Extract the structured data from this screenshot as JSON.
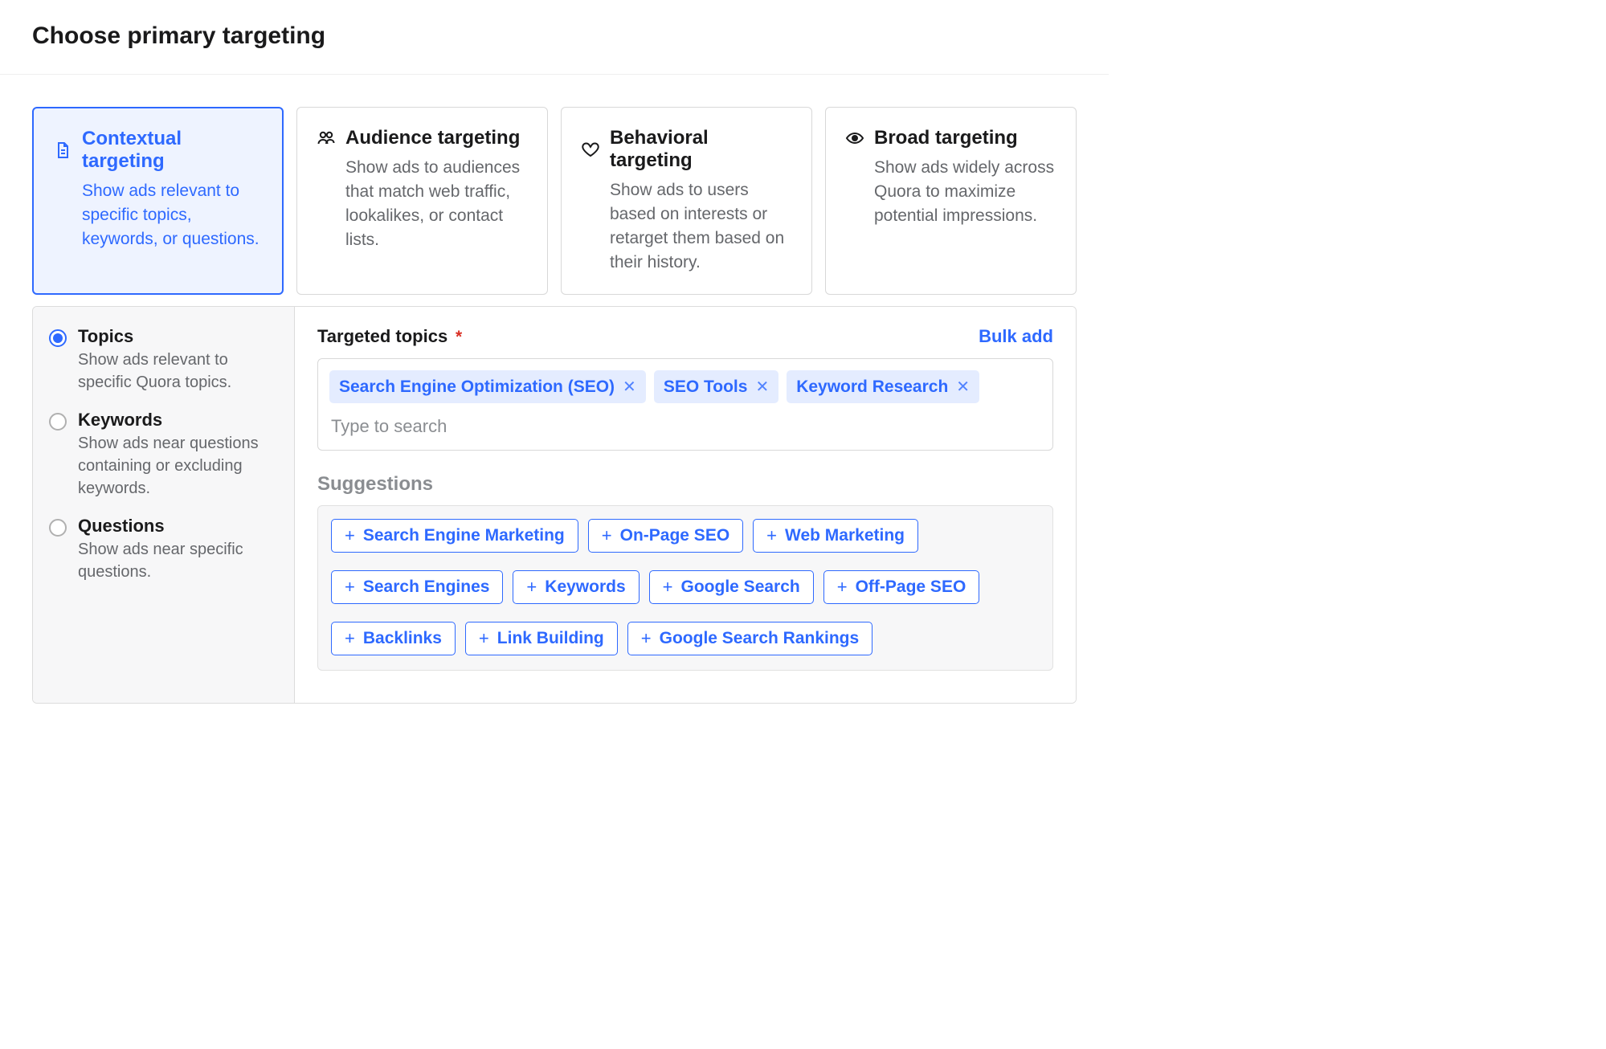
{
  "title": "Choose primary targeting",
  "cards": [
    {
      "title": "Contextual targeting",
      "desc": "Show ads relevant to specific topics, keywords, or questions.",
      "selected": true,
      "icon": "document-icon"
    },
    {
      "title": "Audience targeting",
      "desc": "Show ads to audiences that match web traffic, lookalikes, or contact lists.",
      "selected": false,
      "icon": "people-icon"
    },
    {
      "title": "Behavioral targeting",
      "desc": "Show ads to users based on interests or retarget them based on their history.",
      "selected": false,
      "icon": "heart-icon"
    },
    {
      "title": "Broad targeting",
      "desc": "Show ads widely across Quora to maximize potential impressions.",
      "selected": false,
      "icon": "eye-icon"
    }
  ],
  "side": {
    "options": [
      {
        "label": "Topics",
        "desc": "Show ads relevant to specific Quora topics.",
        "checked": true
      },
      {
        "label": "Keywords",
        "desc": "Show ads near questions containing or excluding keywords.",
        "checked": false
      },
      {
        "label": "Questions",
        "desc": "Show ads near specific questions.",
        "checked": false
      }
    ]
  },
  "main": {
    "field_label": "Targeted topics",
    "required_mark": "*",
    "bulk_add": "Bulk add",
    "chips": [
      "Search Engine Optimization (SEO)",
      "SEO Tools",
      "Keyword Research"
    ],
    "search_placeholder": "Type to search",
    "suggestions_label": "Suggestions",
    "suggestions": [
      "Search Engine Marketing",
      "On-Page SEO",
      "Web Marketing",
      "Search Engines",
      "Keywords",
      "Google Search",
      "Off-Page SEO",
      "Backlinks",
      "Link Building",
      "Google Search Rankings"
    ]
  }
}
